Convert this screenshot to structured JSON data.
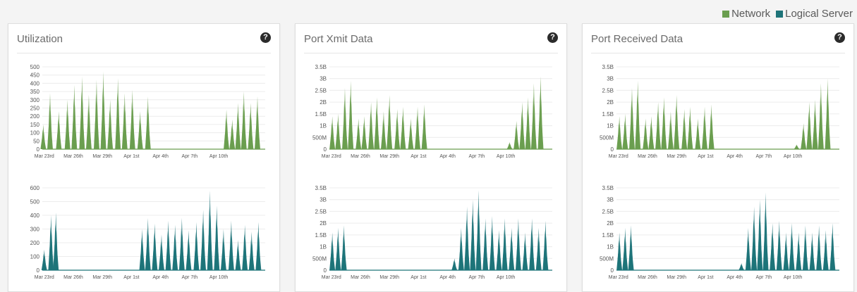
{
  "legend": {
    "items": [
      {
        "label": "Network",
        "color": "#6a9e4f"
      },
      {
        "label": "Logical Server",
        "color": "#1e7479"
      }
    ]
  },
  "colors": {
    "network": "#6a9e4f",
    "logical": "#1e7479"
  },
  "panels": [
    {
      "title": "Utilization",
      "help_icon": "question-circle-icon"
    },
    {
      "title": "Port Xmit Data",
      "help_icon": "question-circle-icon"
    },
    {
      "title": "Port Received Data",
      "help_icon": "question-circle-icon"
    }
  ],
  "chart_data": [
    {
      "type": "area",
      "panel": "Utilization",
      "series_type": "Network",
      "x_ticks": [
        "Mar 23rd",
        "Mar 26th",
        "Mar 29th",
        "Apr 1st",
        "Apr 4th",
        "Apr 7th",
        "Apr 10th"
      ],
      "y_ticks": [
        "0",
        "50",
        "100",
        "150",
        "200",
        "250",
        "300",
        "350",
        "400",
        "450",
        "500"
      ],
      "ylim": [
        0,
        500
      ],
      "peaks": [
        {
          "day": 0.1,
          "value": 150
        },
        {
          "day": 0.8,
          "value": 340
        },
        {
          "day": 1.7,
          "value": 230
        },
        {
          "day": 2.6,
          "value": 300
        },
        {
          "day": 3.3,
          "value": 390
        },
        {
          "day": 4.1,
          "value": 440
        },
        {
          "day": 4.8,
          "value": 330
        },
        {
          "day": 5.6,
          "value": 420
        },
        {
          "day": 6.3,
          "value": 470
        },
        {
          "day": 7.0,
          "value": 300
        },
        {
          "day": 7.8,
          "value": 430
        },
        {
          "day": 8.5,
          "value": 340
        },
        {
          "day": 9.3,
          "value": 360
        },
        {
          "day": 10.1,
          "value": 230
        },
        {
          "day": 10.9,
          "value": 320
        },
        {
          "day": 19.0,
          "value": 240
        },
        {
          "day": 19.6,
          "value": 180
        },
        {
          "day": 20.2,
          "value": 280
        },
        {
          "day": 20.8,
          "value": 350
        },
        {
          "day": 21.5,
          "value": 280
        },
        {
          "day": 22.2,
          "value": 320
        }
      ]
    },
    {
      "type": "area",
      "panel": "Utilization",
      "series_type": "Logical Server",
      "x_ticks": [
        "Mar 23rd",
        "Mar 26th",
        "Mar 29th",
        "Apr 1st",
        "Apr 4th",
        "Apr 7th",
        "Apr 10th"
      ],
      "y_ticks": [
        "0",
        "100",
        "200",
        "300",
        "400",
        "500",
        "600"
      ],
      "ylim": [
        0,
        600
      ],
      "peaks": [
        {
          "day": 0.2,
          "value": 150
        },
        {
          "day": 0.9,
          "value": 400
        },
        {
          "day": 1.4,
          "value": 420
        },
        {
          "day": 10.3,
          "value": 300
        },
        {
          "day": 10.9,
          "value": 380
        },
        {
          "day": 11.6,
          "value": 340
        },
        {
          "day": 12.3,
          "value": 260
        },
        {
          "day": 13.0,
          "value": 360
        },
        {
          "day": 13.7,
          "value": 330
        },
        {
          "day": 14.4,
          "value": 380
        },
        {
          "day": 15.1,
          "value": 290
        },
        {
          "day": 15.9,
          "value": 350
        },
        {
          "day": 16.6,
          "value": 440
        },
        {
          "day": 17.3,
          "value": 580
        },
        {
          "day": 18.0,
          "value": 470
        },
        {
          "day": 18.7,
          "value": 300
        },
        {
          "day": 19.5,
          "value": 360
        },
        {
          "day": 20.2,
          "value": 220
        },
        {
          "day": 20.9,
          "value": 330
        },
        {
          "day": 21.6,
          "value": 280
        },
        {
          "day": 22.3,
          "value": 350
        }
      ]
    },
    {
      "type": "area",
      "panel": "Port Xmit Data",
      "series_type": "Network",
      "x_ticks": [
        "Mar 23rd",
        "Mar 26th",
        "Mar 29th",
        "Apr 1st",
        "Apr 4th",
        "Apr 7th",
        "Apr 10th"
      ],
      "y_ticks": [
        "0",
        "500M",
        "1B",
        "1.5B",
        "2B",
        "2.5B",
        "3B",
        "3.5B"
      ],
      "ylim": [
        0,
        3.5
      ],
      "peaks": [
        {
          "day": 0.3,
          "value": 1.4
        },
        {
          "day": 0.9,
          "value": 1.5
        },
        {
          "day": 1.6,
          "value": 2.6
        },
        {
          "day": 2.2,
          "value": 2.9
        },
        {
          "day": 3.0,
          "value": 1.3
        },
        {
          "day": 3.6,
          "value": 1.4
        },
        {
          "day": 4.3,
          "value": 2.0
        },
        {
          "day": 4.9,
          "value": 2.2
        },
        {
          "day": 5.6,
          "value": 1.6
        },
        {
          "day": 6.2,
          "value": 2.3
        },
        {
          "day": 7.0,
          "value": 1.7
        },
        {
          "day": 7.6,
          "value": 1.8
        },
        {
          "day": 8.4,
          "value": 1.3
        },
        {
          "day": 9.1,
          "value": 1.8
        },
        {
          "day": 9.8,
          "value": 1.9
        },
        {
          "day": 18.6,
          "value": 0.3
        },
        {
          "day": 19.3,
          "value": 1.2
        },
        {
          "day": 19.9,
          "value": 2.0
        },
        {
          "day": 20.5,
          "value": 2.2
        },
        {
          "day": 21.1,
          "value": 2.8
        },
        {
          "day": 21.8,
          "value": 3.1
        }
      ]
    },
    {
      "type": "area",
      "panel": "Port Xmit Data",
      "series_type": "Logical Server",
      "x_ticks": [
        "Mar 23rd",
        "Mar 26th",
        "Mar 29th",
        "Apr 1st",
        "Apr 4th",
        "Apr 7th",
        "Apr 10th"
      ],
      "y_ticks": [
        "0",
        "500M",
        "1B",
        "1.5B",
        "2B",
        "2.5B",
        "3B",
        "3.5B"
      ],
      "ylim": [
        0,
        3.5
      ],
      "peaks": [
        {
          "day": 0.3,
          "value": 1.6
        },
        {
          "day": 0.9,
          "value": 1.8
        },
        {
          "day": 1.5,
          "value": 1.9
        },
        {
          "day": 12.9,
          "value": 0.5
        },
        {
          "day": 13.6,
          "value": 1.8
        },
        {
          "day": 14.2,
          "value": 2.7
        },
        {
          "day": 14.8,
          "value": 3.0
        },
        {
          "day": 15.4,
          "value": 3.4
        },
        {
          "day": 16.1,
          "value": 2.2
        },
        {
          "day": 16.8,
          "value": 2.3
        },
        {
          "day": 17.5,
          "value": 1.7
        },
        {
          "day": 18.1,
          "value": 2.2
        },
        {
          "day": 18.8,
          "value": 1.8
        },
        {
          "day": 19.5,
          "value": 2.2
        },
        {
          "day": 20.2,
          "value": 1.6
        },
        {
          "day": 20.9,
          "value": 2.2
        },
        {
          "day": 21.6,
          "value": 1.8
        },
        {
          "day": 22.3,
          "value": 2.1
        }
      ]
    },
    {
      "type": "area",
      "panel": "Port Received Data",
      "series_type": "Network",
      "x_ticks": [
        "Mar 23rd",
        "Mar 26th",
        "Mar 29th",
        "Apr 1st",
        "Apr 4th",
        "Apr 7th",
        "Apr 10th"
      ],
      "y_ticks": [
        "0",
        "500M",
        "1B",
        "1.5B",
        "2B",
        "2.5B",
        "3B",
        "3.5B"
      ],
      "ylim": [
        0,
        3.5
      ],
      "peaks": [
        {
          "day": 0.3,
          "value": 1.4
        },
        {
          "day": 0.9,
          "value": 1.5
        },
        {
          "day": 1.6,
          "value": 2.6
        },
        {
          "day": 2.2,
          "value": 2.9
        },
        {
          "day": 3.0,
          "value": 1.3
        },
        {
          "day": 3.6,
          "value": 1.4
        },
        {
          "day": 4.3,
          "value": 2.0
        },
        {
          "day": 4.9,
          "value": 2.2
        },
        {
          "day": 5.6,
          "value": 1.6
        },
        {
          "day": 6.2,
          "value": 2.3
        },
        {
          "day": 7.0,
          "value": 1.7
        },
        {
          "day": 7.6,
          "value": 1.8
        },
        {
          "day": 8.4,
          "value": 1.3
        },
        {
          "day": 9.1,
          "value": 1.8
        },
        {
          "day": 9.8,
          "value": 1.9
        },
        {
          "day": 18.6,
          "value": 0.2
        },
        {
          "day": 19.3,
          "value": 1.1
        },
        {
          "day": 19.9,
          "value": 2.0
        },
        {
          "day": 20.5,
          "value": 2.1
        },
        {
          "day": 21.1,
          "value": 2.8
        },
        {
          "day": 21.8,
          "value": 3.0
        }
      ]
    },
    {
      "type": "area",
      "panel": "Port Received Data",
      "series_type": "Logical Server",
      "x_ticks": [
        "Mar 23rd",
        "Mar 26th",
        "Mar 29th",
        "Apr 1st",
        "Apr 4th",
        "Apr 7th",
        "Apr 10th"
      ],
      "y_ticks": [
        "0",
        "500M",
        "1B",
        "1.5B",
        "2B",
        "2.5B",
        "3B",
        "3.5B"
      ],
      "ylim": [
        0,
        3.5
      ],
      "peaks": [
        {
          "day": 0.3,
          "value": 1.6
        },
        {
          "day": 0.9,
          "value": 1.8
        },
        {
          "day": 1.5,
          "value": 1.9
        },
        {
          "day": 12.9,
          "value": 0.3
        },
        {
          "day": 13.6,
          "value": 1.8
        },
        {
          "day": 14.2,
          "value": 2.7
        },
        {
          "day": 14.8,
          "value": 3.0
        },
        {
          "day": 15.4,
          "value": 3.3
        },
        {
          "day": 16.1,
          "value": 2.0
        },
        {
          "day": 16.8,
          "value": 2.1
        },
        {
          "day": 17.5,
          "value": 1.6
        },
        {
          "day": 18.1,
          "value": 2.0
        },
        {
          "day": 18.8,
          "value": 1.6
        },
        {
          "day": 19.5,
          "value": 1.9
        },
        {
          "day": 20.2,
          "value": 1.6
        },
        {
          "day": 20.9,
          "value": 1.9
        },
        {
          "day": 21.6,
          "value": 1.7
        },
        {
          "day": 22.3,
          "value": 2.0
        }
      ]
    }
  ]
}
